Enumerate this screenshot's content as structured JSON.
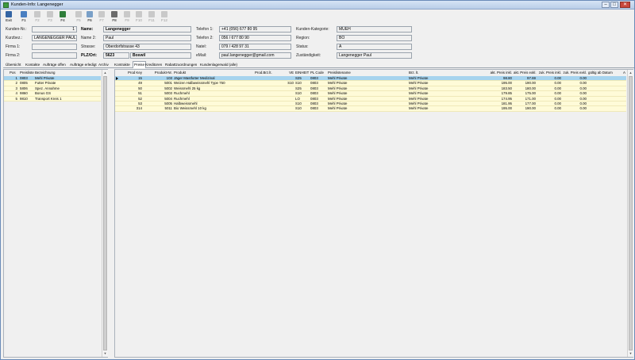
{
  "window": {
    "title": "Kunden-Info: Langenegger",
    "min": "–",
    "max": "□",
    "close": "✕"
  },
  "toolbar": [
    {
      "label": "Exit",
      "icon": "exit-icon",
      "color": "#3465a4",
      "enabled": true
    },
    {
      "label": "F1",
      "icon": "help-icon",
      "color": "#4a7fc1",
      "enabled": true
    },
    {
      "label": "F2",
      "icon": "new-document-icon",
      "color": "#9bb6d6",
      "enabled": false
    },
    {
      "label": "F3",
      "icon": "delete-icon",
      "color": "#bbbbbb",
      "enabled": false
    },
    {
      "label": "F4",
      "icon": "save-icon",
      "color": "#2f7e3a",
      "enabled": true
    },
    {
      "label": "F5",
      "icon": "copy-icon",
      "color": "#bbbbbb",
      "enabled": false
    },
    {
      "label": "F6",
      "icon": "search-icon",
      "color": "#7aa0c8",
      "enabled": true
    },
    {
      "label": "F7",
      "icon": "filter-icon",
      "color": "#bbbbbb",
      "enabled": false
    },
    {
      "label": "F8",
      "icon": "print-icon",
      "color": "#6b6b6b",
      "enabled": true
    },
    {
      "label": "F9",
      "icon": "document-icon",
      "color": "#bbbbbb",
      "enabled": false
    },
    {
      "label": "F10",
      "icon": "blank-icon",
      "color": "#bbbbbb",
      "enabled": false
    },
    {
      "label": "F11",
      "icon": "blank-icon",
      "color": "#bbbbbb",
      "enabled": false
    },
    {
      "label": "F12",
      "icon": "blank-icon",
      "color": "#bbbbbb",
      "enabled": false
    }
  ],
  "customer": {
    "nr_label": "Kunden-Nr.:",
    "nr": "1",
    "kurzbez_label": "Kurzbez.:",
    "kurzbez": "LANGENEGGER PAUL",
    "firma1_label": "Firma 1:",
    "firma1": "",
    "firma2_label": "Firma 2:",
    "firma2": "",
    "name_label": "Name:",
    "name": "Langenegger",
    "vorname_label": "Name 2:",
    "vorname": "Paul",
    "strasse_label": "Strasse:",
    "strasse": "Oberdorfstrasse 43",
    "plzort_label": "PLZ/Ort:",
    "plz": "5623",
    "ort": "Boswil",
    "tel1_label": "Telefon 1:",
    "tel1": "+41 (056) 677 80 95",
    "tel2_label": "Telefon 2:",
    "tel2": "056 / 677 80 90",
    "natel_label": "Natel:",
    "natel": "079 / 428 97 31",
    "email_label": "eMail:",
    "email": "paul.langenegger@gmail.com",
    "kat_label": "Kunden-Kategorie:",
    "kat": "MUEH",
    "region_label": "Region:",
    "region": "BO",
    "status_label": "Status:",
    "status": "A",
    "zust_label": "Zuständigkeit:",
    "zust": "Langenegger Paul"
  },
  "tabs": [
    "Übersicht",
    "Kontakte",
    "Aufträge offen",
    "Aufträge erledigt",
    "Archiv",
    "Kontrakte",
    "Preise",
    "Kreditoren",
    "Rabattzuordnungen",
    "Kundenlagerwald (alle)"
  ],
  "selected_tab": 6,
  "left": {
    "headers": [
      "Pos",
      "Preisliste",
      "Bezeichnung"
    ],
    "rows": [
      [
        "1",
        "0803",
        "Mehl Private"
      ],
      [
        "2",
        "0805",
        "Futter Private"
      ],
      [
        "3",
        "5806",
        "Spez. Annahme"
      ],
      [
        "4",
        "9860",
        "Bonus GS"
      ],
      [
        "5",
        "9810",
        "Transport Kreis 1"
      ]
    ]
  },
  "right": {
    "headers": [
      "Prod Key",
      "Produkt-Nr.",
      "Produkt",
      "Prod.Brz.lt.",
      "VE",
      "EINHEIT",
      "PL Code",
      "Preislistename",
      "Brz. lt.",
      "akt. Preis inkl.",
      "akt. Preis exkl.",
      "zuk. Preis inkl.",
      "zuk. Preis exkl.",
      "gültig ab Datum",
      "A"
    ],
    "rows": [
      [
        "15",
        "103",
        "Jäger Mastfutter Medizinal",
        "",
        "",
        "S25",
        "0803",
        "Mehl Private",
        "Mehl Private",
        "98.80",
        "97.69",
        "0.00",
        "0.00",
        ""
      ],
      [
        "49",
        "5001",
        "Weizen Halbweissmehl Type 750",
        "",
        "S10",
        "S10",
        "0803",
        "Mehl Private",
        "Mehl Private",
        "195.00",
        "190.00",
        "0.00",
        "0.00",
        ""
      ],
      [
        "50",
        "5002",
        "Weissmehl 25 kg",
        "",
        "",
        "S25",
        "0803",
        "Mehl Private",
        "Mehl Private",
        "183.50",
        "180.00",
        "0.00",
        "0.00",
        ""
      ],
      [
        "51",
        "5003",
        "Ruchmehl",
        "",
        "",
        "S10",
        "0803",
        "Mehl Private",
        "Mehl Private",
        "179.85",
        "175.00",
        "0.00",
        "0.00",
        ""
      ],
      [
        "52",
        "5004",
        "Ruchmehl",
        "",
        "",
        "LO",
        "0803",
        "Mehl Private",
        "Mehl Private",
        "174.95",
        "171.00",
        "0.00",
        "0.00",
        ""
      ],
      [
        "53",
        "5005",
        "Halbweissmehl",
        "",
        "",
        "S10",
        "0803",
        "Mehl Private",
        "Mehl Private",
        "181.95",
        "177.00",
        "0.00",
        "0.00",
        ""
      ],
      [
        "314",
        "5011",
        "Bio Weissmehl 10 kg",
        "",
        "",
        "S10",
        "0803",
        "Mehl Private",
        "Mehl Private",
        "195.00",
        "190.00",
        "0.00",
        "0.00",
        ""
      ]
    ]
  }
}
